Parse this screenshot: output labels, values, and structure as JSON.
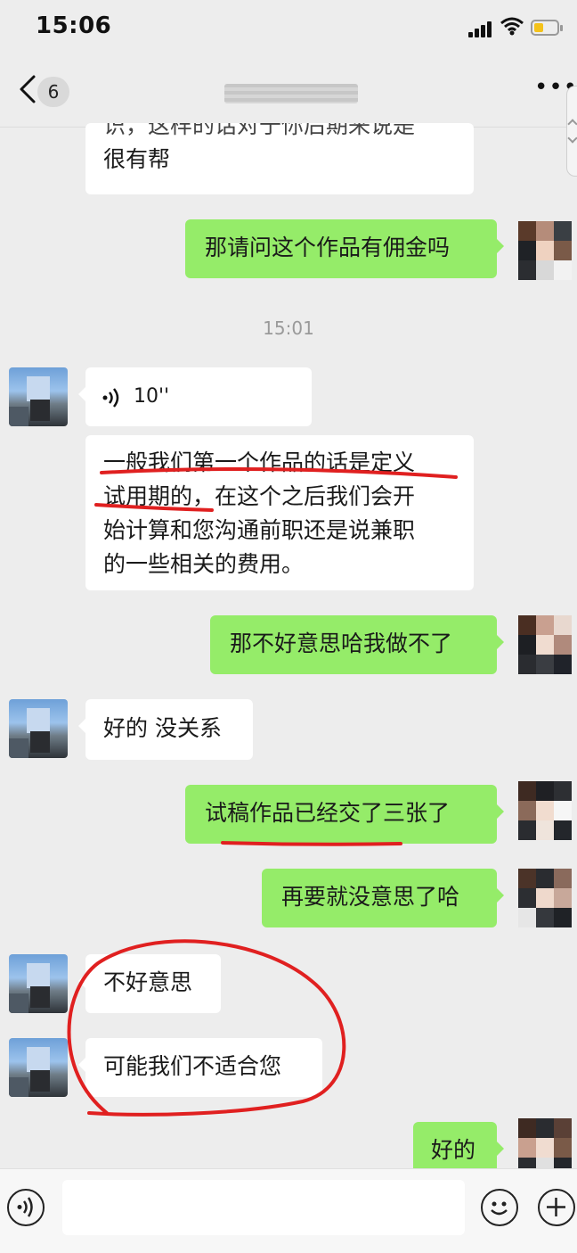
{
  "status_bar": {
    "time": "15:06"
  },
  "nav": {
    "unread_count": "6"
  },
  "messages": [
    {
      "side": "in",
      "text_line1": "识，这样的话对于你后期来说是",
      "text_line2": "很有帮"
    },
    {
      "side": "out",
      "text": "那请问这个作品有佣金吗"
    },
    {
      "timestamp": "15:01"
    },
    {
      "side": "in",
      "type": "voice",
      "duration": "10''"
    },
    {
      "side": "in",
      "lines": [
        "一般我们第一个作品的话是定义",
        "试用期的，在这个之后我们会开",
        "始计算和您沟通前职还是说兼职",
        "的一些相关的费用。"
      ]
    },
    {
      "side": "out",
      "text": "那不好意思哈我做不了"
    },
    {
      "side": "in",
      "text": "好的 没关系"
    },
    {
      "side": "out",
      "text": "试稿作品已经交了三张了"
    },
    {
      "side": "out",
      "text": "再要就没意思了哈"
    },
    {
      "side": "in",
      "text": "不好意思"
    },
    {
      "side": "in",
      "text": "可能我们不适合您"
    },
    {
      "side": "out",
      "text": "好的"
    }
  ],
  "colors": {
    "out_bubble": "#95ec69",
    "in_bubble": "#ffffff",
    "annotation": "#e02020"
  },
  "icons": {
    "back": "chevron-left-icon",
    "more": "more-dots-icon",
    "voice": "voice-icon",
    "emoji": "emoji-icon",
    "add": "plus-icon"
  }
}
